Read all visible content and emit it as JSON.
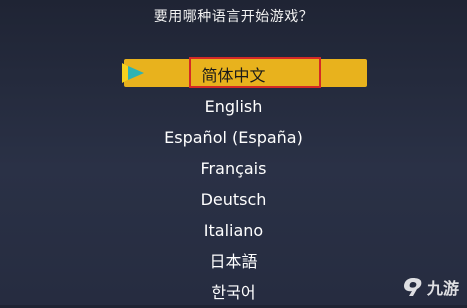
{
  "title": "要用哪种语言开始游戏？",
  "languages": [
    {
      "label": "简体中文",
      "selected": true
    },
    {
      "label": "English",
      "selected": false
    },
    {
      "label": "Español (España)",
      "selected": false
    },
    {
      "label": "Français",
      "selected": false
    },
    {
      "label": "Deutsch",
      "selected": false
    },
    {
      "label": "Italiano",
      "selected": false
    },
    {
      "label": "日本語",
      "selected": false
    },
    {
      "label": "한국어",
      "selected": false
    }
  ],
  "watermark": {
    "text": "九游",
    "icon": "jiuyou-logo-icon"
  },
  "colors": {
    "highlight": "#e8b21d",
    "selection_border": "#d42a25",
    "arrow_teal": "#2fb3b3",
    "arrow_yellow": "#f5d21d"
  }
}
